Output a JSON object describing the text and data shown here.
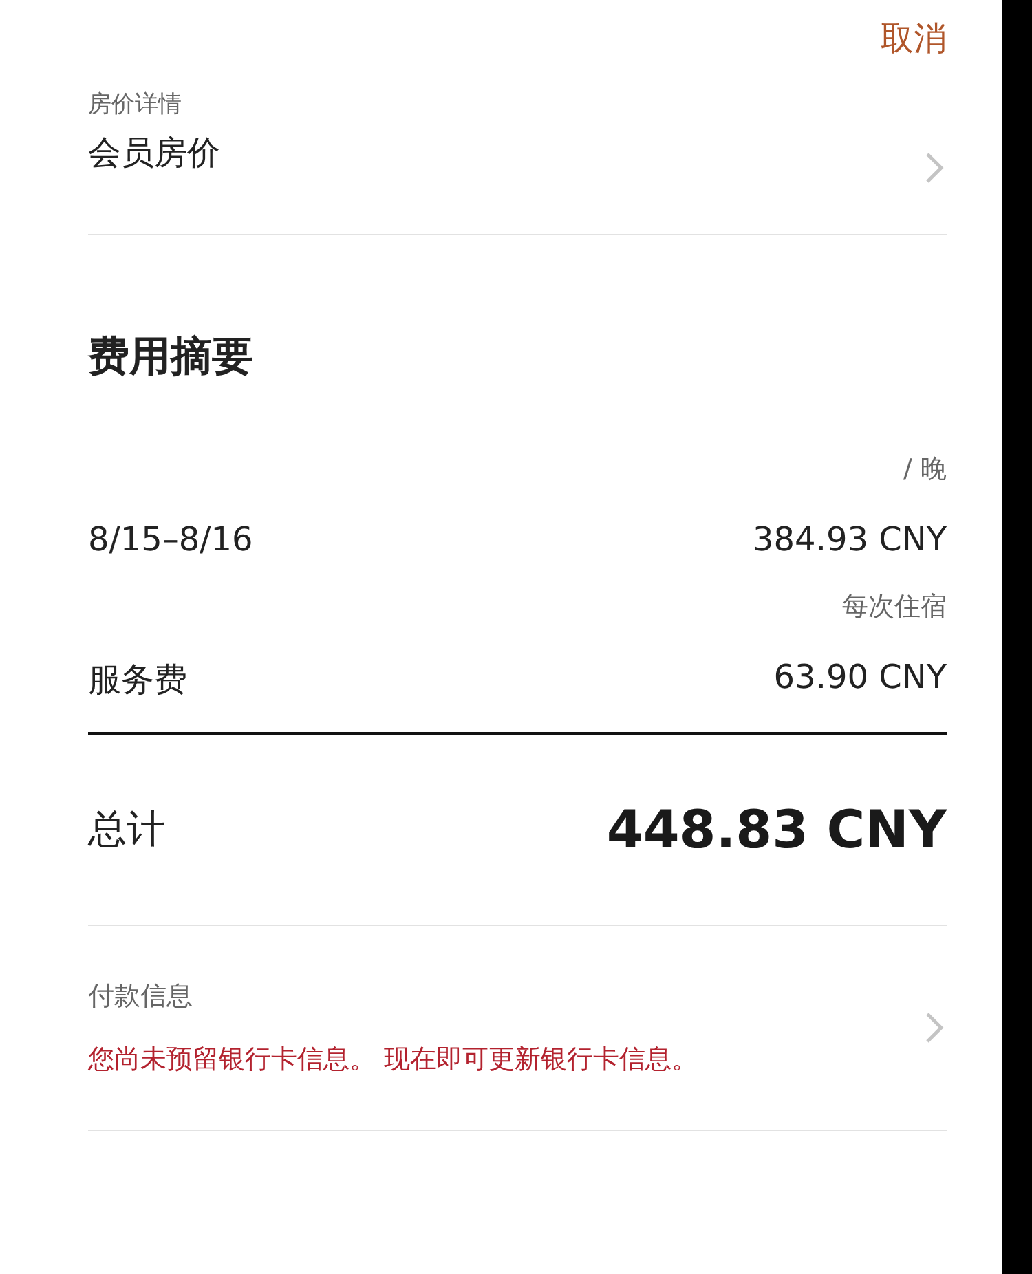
{
  "header": {
    "cancel": "取消"
  },
  "rate": {
    "label": "房价详情",
    "value": "会员房价"
  },
  "summary": {
    "title": "费用摘要",
    "items": [
      {
        "unit": "/ 晚",
        "label": "8/15–8/16",
        "amount": "384.93 CNY"
      },
      {
        "unit": "每次住宿",
        "label": "服务费",
        "amount": "63.90 CNY"
      }
    ],
    "total": {
      "label": "总计",
      "amount": "448.83 CNY"
    }
  },
  "payment": {
    "label": "付款信息",
    "warning": "您尚未预留银行卡信息。 现在即可更新银行卡信息。"
  }
}
